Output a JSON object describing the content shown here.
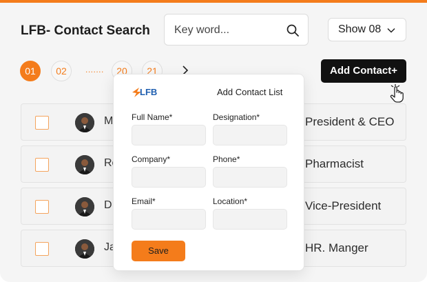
{
  "header": {
    "title": "LFB- Contact Search",
    "search_placeholder": "Key word...",
    "show_label": "Show 08",
    "add_button": "Add Contact+"
  },
  "pagination": {
    "pages": [
      "01",
      "02",
      "20",
      "21"
    ],
    "active": "01",
    "ellipsis": "......."
  },
  "contacts": [
    {
      "name": "M",
      "role": "President & CEO"
    },
    {
      "name": "Ro",
      "role": "Pharmacist"
    },
    {
      "name": "D",
      "role": "Vice-President"
    },
    {
      "name": "Ja",
      "role": "HR. Manger"
    }
  ],
  "modal": {
    "logo_text": "LFB",
    "logo_subtext": "",
    "title": "Add Contact List",
    "fields": [
      {
        "label": "Full Name*",
        "value": ""
      },
      {
        "label": "Designation*",
        "value": ""
      },
      {
        "label": "Company*",
        "value": ""
      },
      {
        "label": "Phone*",
        "value": ""
      },
      {
        "label": "Email*",
        "value": ""
      },
      {
        "label": "Location*",
        "value": ""
      }
    ],
    "save_label": "Save"
  },
  "colors": {
    "accent": "#f47c1b",
    "dark_button": "#111111",
    "background": "#f5f5f5"
  },
  "icons": [
    "search-icon",
    "chevron-down-icon",
    "chevron-right-icon",
    "hand-pointer-icon",
    "lfb-logo"
  ]
}
